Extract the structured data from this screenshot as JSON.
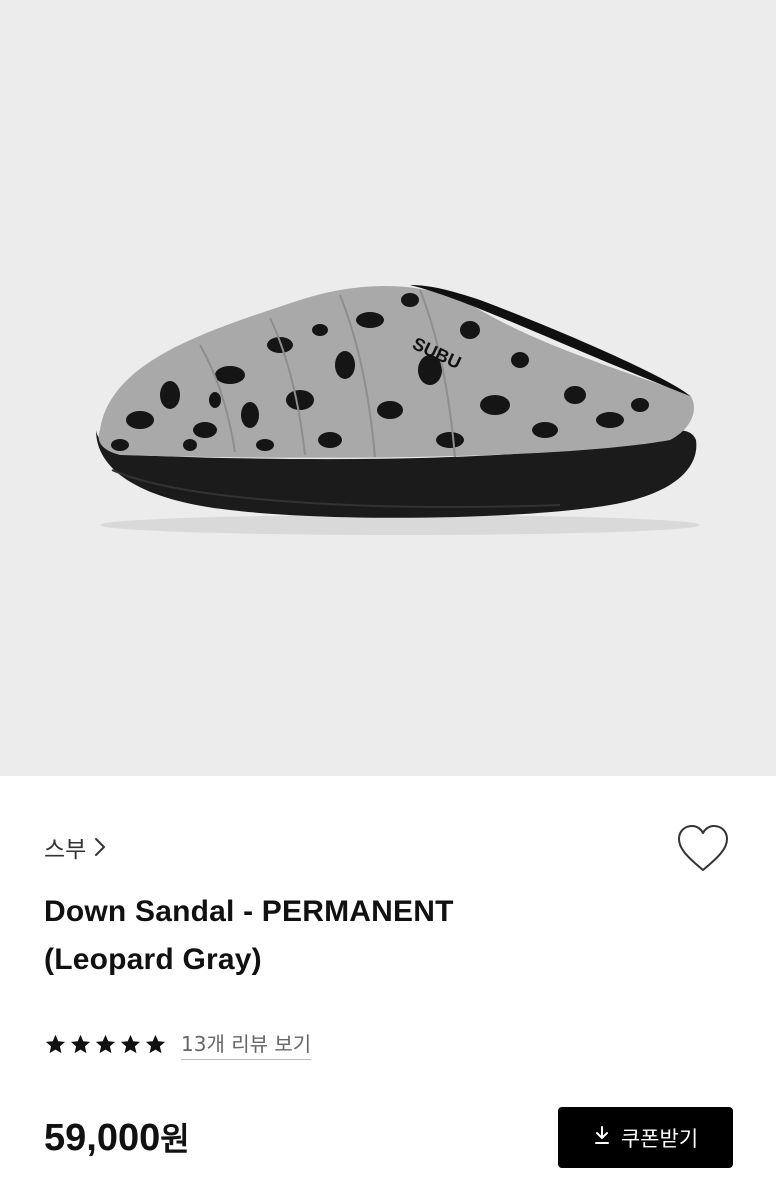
{
  "product": {
    "brand": "스부",
    "title_line1": "Down Sandal - PERMANENT",
    "title_line2": "(Leopard Gray)",
    "image_logo_text": "SUBU",
    "rating": 5,
    "review_link": "13개 리뷰 보기",
    "price": "59,000",
    "price_unit": "원"
  },
  "actions": {
    "coupon_label": "쿠폰받기"
  },
  "icons": {
    "brand_chevron": "chevron-right-icon",
    "wishlist": "heart-outline-icon",
    "coupon": "download-icon",
    "star": "star-filled-icon"
  },
  "colors": {
    "hero_background": "#ececec",
    "button_background": "#000000",
    "text_primary": "#111111"
  }
}
